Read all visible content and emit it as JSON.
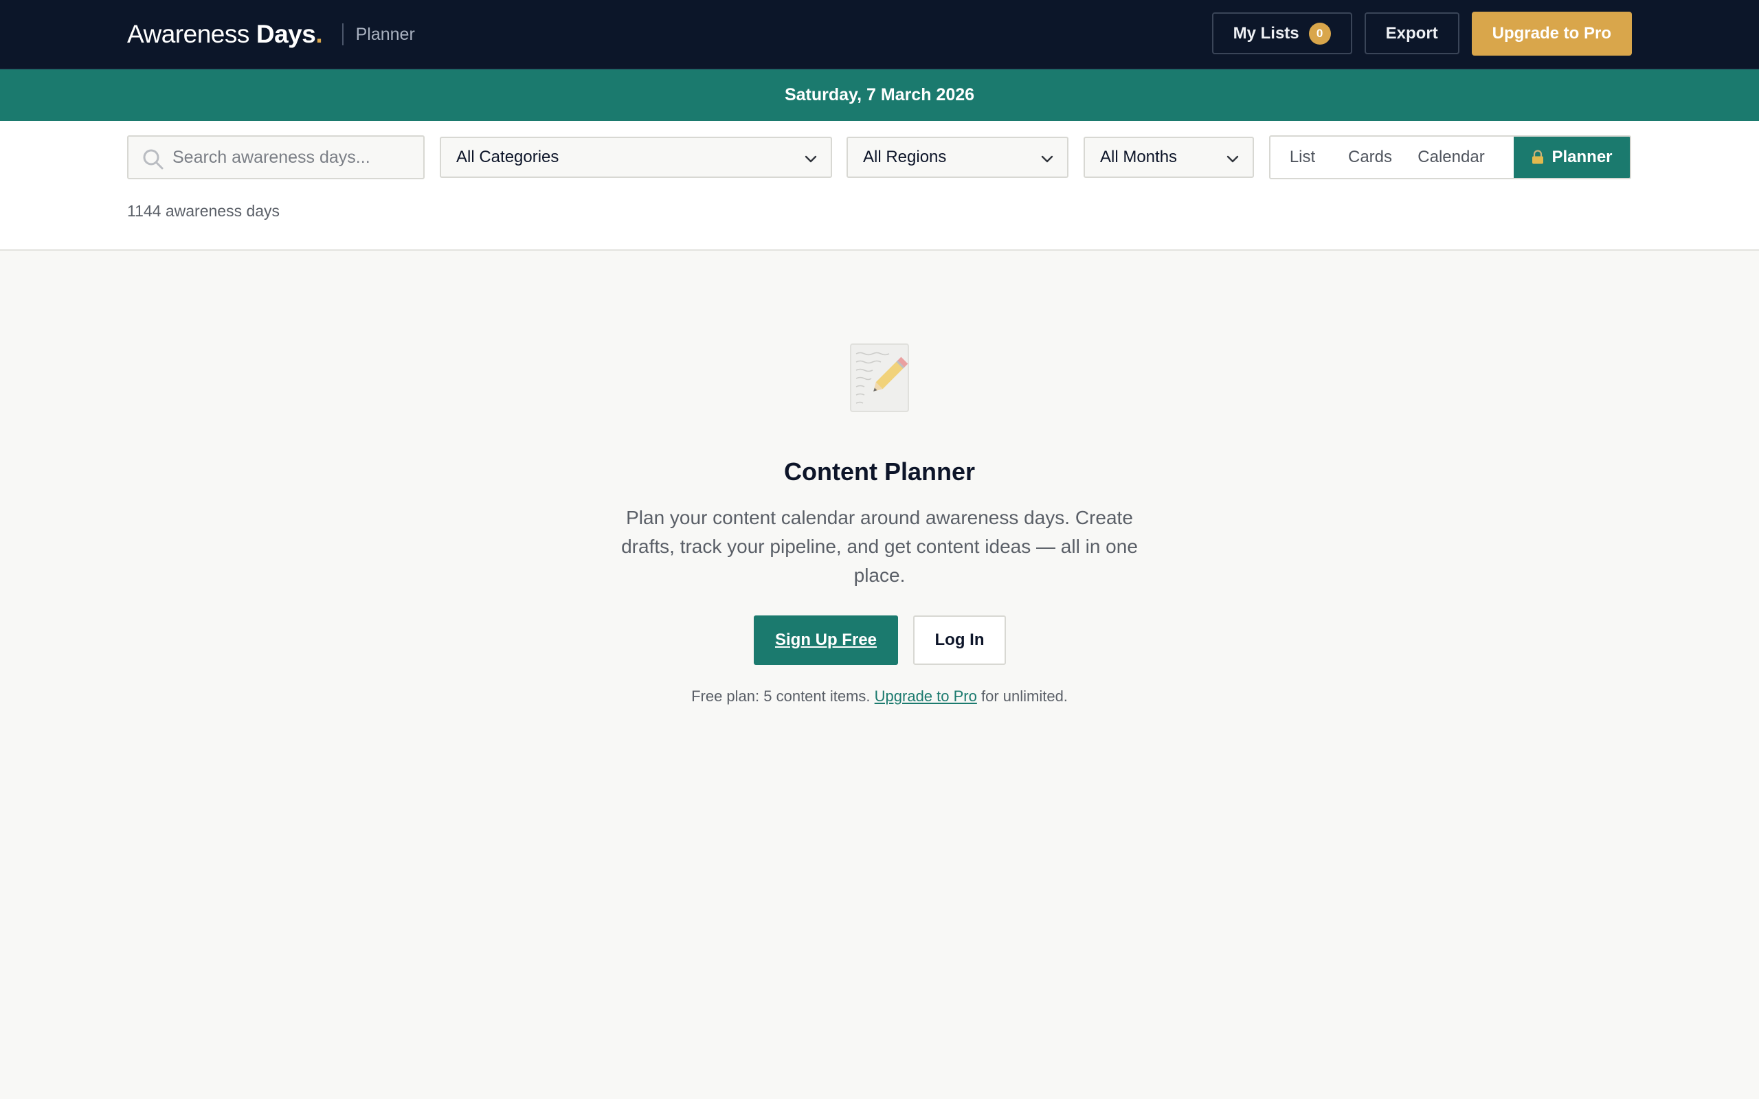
{
  "header": {
    "brand_light": "Awareness",
    "brand_bold": "Days",
    "brand_dot": ".",
    "section": "Planner",
    "my_lists_label": "My Lists",
    "my_lists_count": "0",
    "export_label": "Export",
    "upgrade_label": "Upgrade to Pro"
  },
  "date_banner": "Saturday, 7 March 2026",
  "filters": {
    "search_placeholder": "Search awareness days...",
    "category": "All Categories",
    "region": "All Regions",
    "month": "All Months",
    "views": [
      "List",
      "Cards",
      "Calendar",
      "Planner"
    ],
    "active_view": "Planner",
    "result_count": "1144 awareness days"
  },
  "planner": {
    "icon": "memo-pencil-icon",
    "title": "Content Planner",
    "description": "Plan your content calendar around awareness days. Create drafts, track your pipeline, and get content ideas — all in one place.",
    "signup_label": "Sign Up Free",
    "login_label": "Log In",
    "note_before": "Free plan: 5 content items. ",
    "note_link": "Upgrade to Pro",
    "note_after": " for unlimited."
  },
  "colors": {
    "navy": "#0c1629",
    "teal": "#1b7a6e",
    "gold": "#d9a64b",
    "background": "#f8f8f6"
  }
}
